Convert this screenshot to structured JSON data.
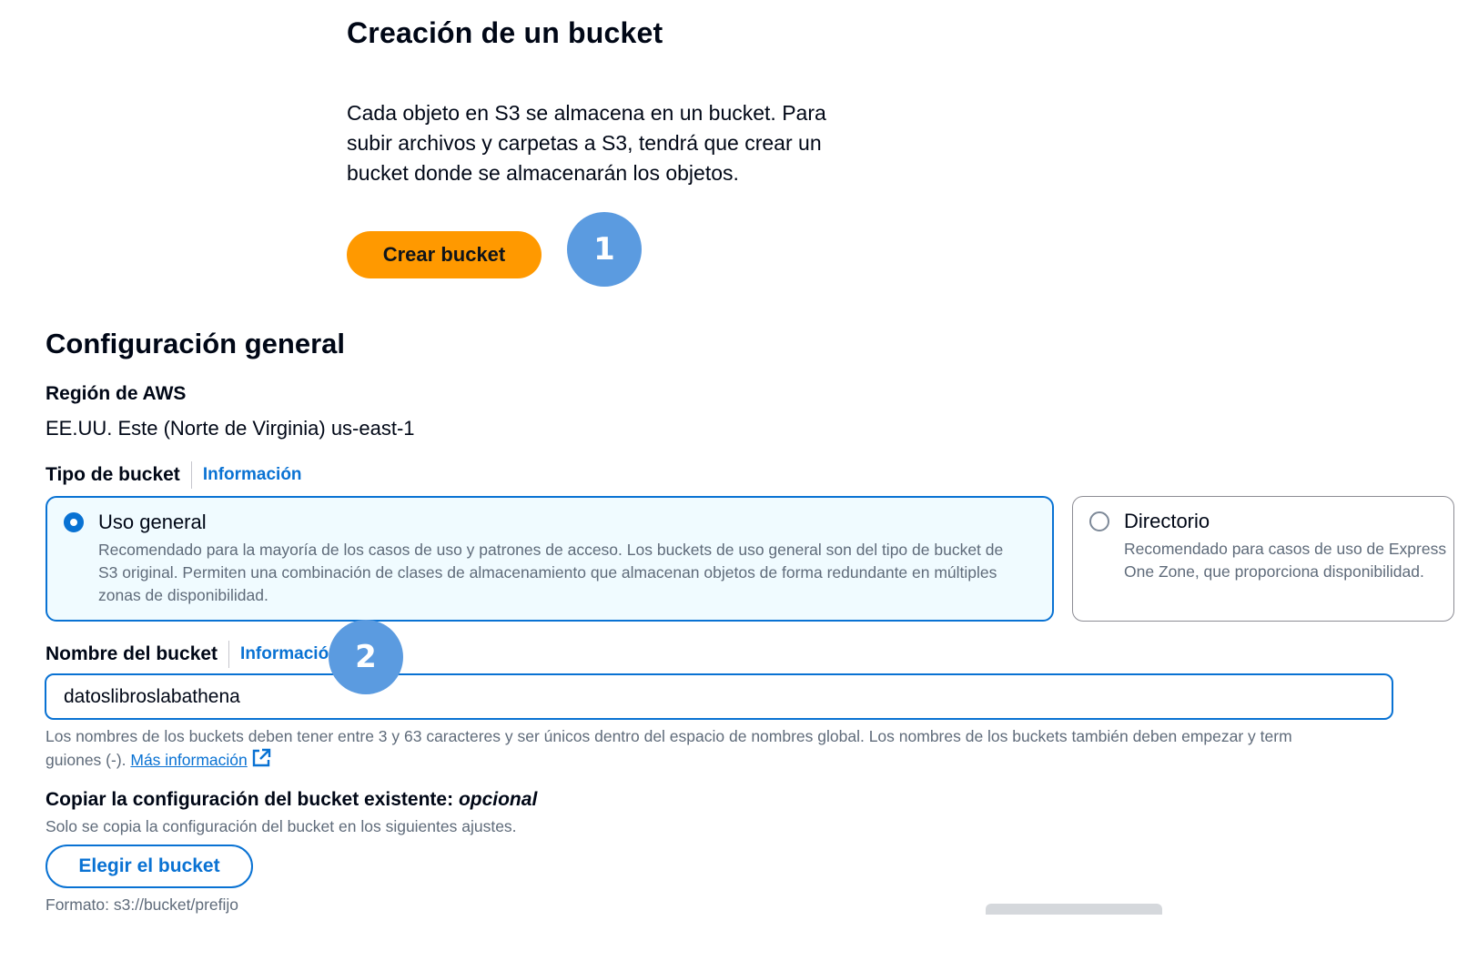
{
  "create_section": {
    "title": "Creación de un bucket",
    "description": "Cada objeto en S3 se almacena en un bucket. Para subir archivos y carpetas a S3, tendrá que crear un bucket donde se almacenarán los objetos.",
    "create_button_label": "Crear bucket"
  },
  "badges": {
    "step1": "1",
    "step2": "2"
  },
  "config": {
    "title": "Configuración general",
    "region_label": "Región de AWS",
    "region_value": "EE.UU. Este (Norte de Virginia) us-east-1",
    "bucket_type_label": "Tipo de bucket",
    "bucket_type_info": "Información",
    "options": [
      {
        "title": "Uso general",
        "description": "Recomendado para la mayoría de los casos de uso y patrones de acceso. Los buckets de uso general son del tipo de bucket de S3 original. Permiten una combinación de clases de almacenamiento que almacenan objetos de forma redundante en múltiples zonas de disponibilidad.",
        "selected": true
      },
      {
        "title": "Directorio",
        "description": "Recomendado para casos de uso de Express One Zone, que proporciona disponibilidad.",
        "selected": false
      }
    ],
    "bucket_name_label": "Nombre del bucket",
    "bucket_name_info": "Información",
    "bucket_name_value": "datoslibroslabathena",
    "bucket_name_hint": "Los nombres de los buckets deben tener entre 3 y 63 caracteres y ser únicos dentro del espacio de nombres global. Los nombres de los buckets también deben empezar y term",
    "bucket_name_hint_line2": "guiones (-). ",
    "more_info_link": "Más información",
    "copy_title": "Copiar la configuración del bucket existente: ",
    "copy_optional": "opcional",
    "copy_desc": "Solo se copia la configuración del bucket en los siguientes ajustes.",
    "choose_button_label": "Elegir el bucket",
    "format_text": "Formato: s3://bucket/prefijo"
  },
  "colors": {
    "primary_button": "#ff9900",
    "link": "#0972d3",
    "badge": "#5b9be0",
    "selected_tile_bg": "#f0fbff"
  },
  "icons": {
    "external_link": "external-link-icon"
  }
}
